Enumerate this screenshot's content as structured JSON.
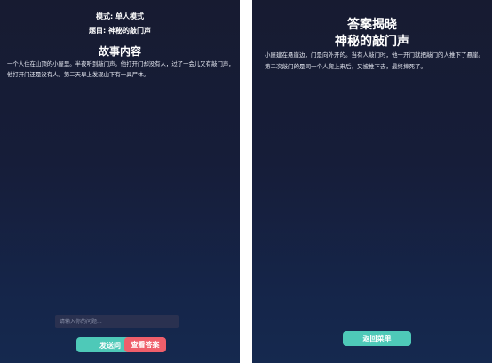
{
  "game_screen": {
    "mode_text": "模式: 单人模式",
    "title_text": "题目: 神秘的敲门声",
    "section_heading": "故事内容",
    "story": "一个人住在山顶的小屋里。半夜听到敲门声。他打开门却没有人，过了一会儿又有敲门声，他打开门还是没有人。第二天早上发现山下有一具尸体。",
    "input_placeholder": "请输入你的问题...",
    "send_label": "发送问",
    "reveal_label": "查看答案"
  },
  "answer_screen": {
    "heading": "答案揭晓",
    "puzzle_title": "神秘的敲门声",
    "answer": "小屋建在悬崖边，门是向外开的。当有人敲门时，他一开门就把敲门的人推下了悬崖。第二次敲门的是同一个人爬上来后，又被推下去，最终摔死了。",
    "back_label": "返回菜单"
  },
  "colors": {
    "background_top": "#171b31",
    "background_bottom": "#15294f",
    "accent_teal": "#4ec9b8",
    "accent_red": "#ef5f6b"
  }
}
